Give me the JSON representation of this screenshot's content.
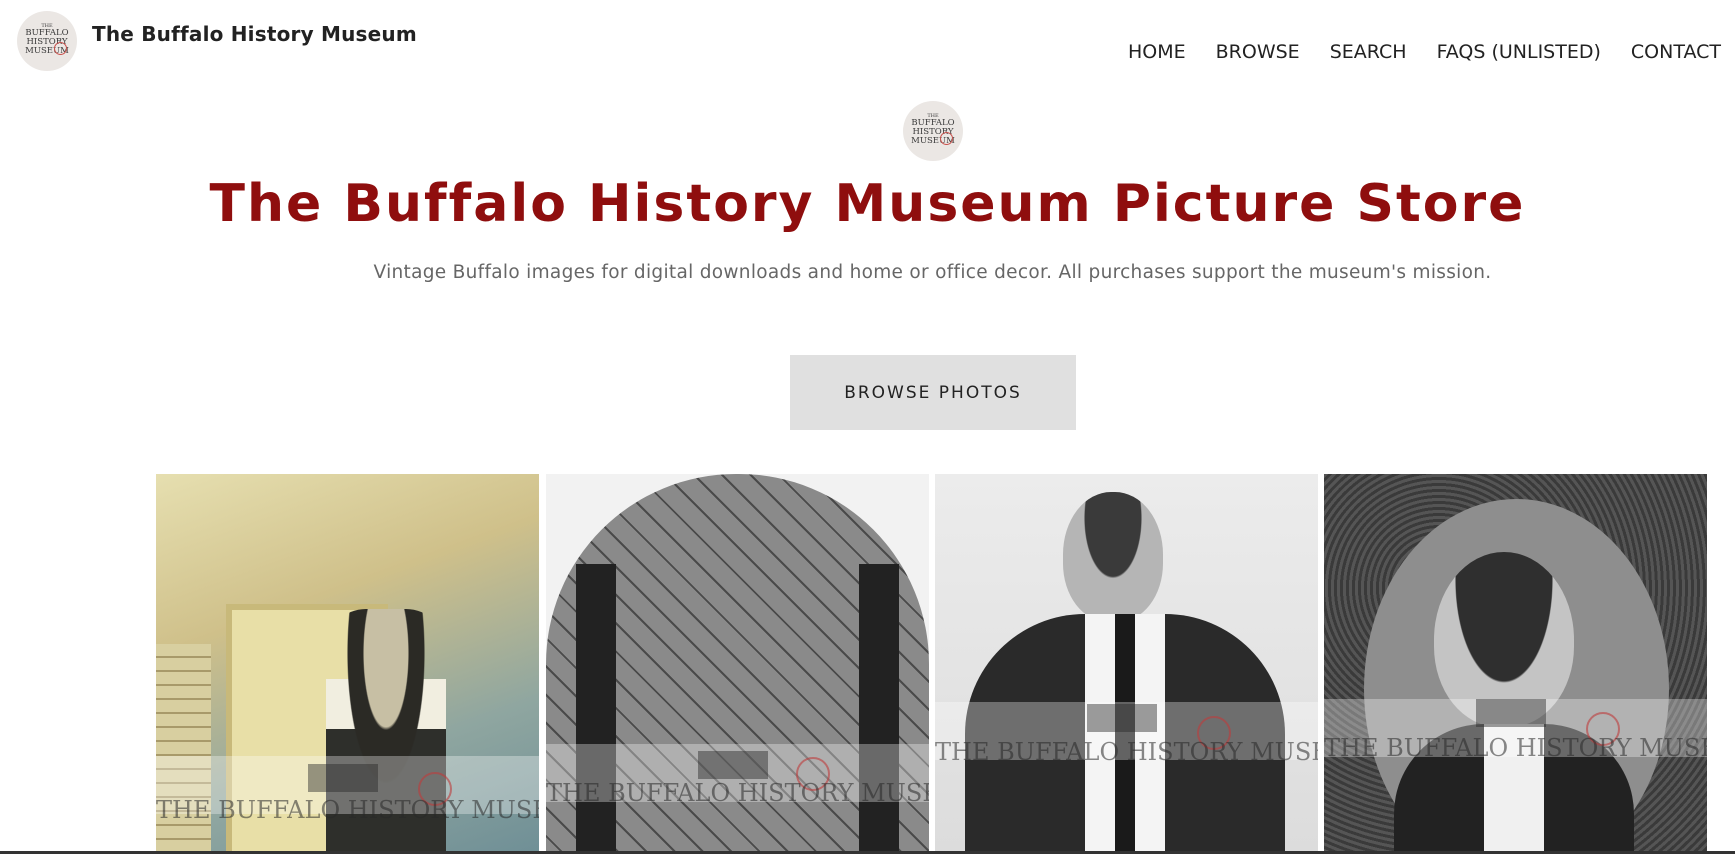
{
  "header": {
    "logo_alt": "The Buffalo History Museum logo",
    "logo_lines": [
      "THE",
      "BUFFALO",
      "HISTORY",
      "MUSEUM"
    ],
    "site_title": "The Buffalo History Museum"
  },
  "nav": {
    "items": [
      {
        "label": "HOME"
      },
      {
        "label": "BROWSE"
      },
      {
        "label": "SEARCH"
      },
      {
        "label": "FAQS (UNLISTED)"
      },
      {
        "label": "CONTACT"
      }
    ]
  },
  "hero": {
    "title": "The Buffalo History Museum Picture Store",
    "subtitle": "Vintage Buffalo images for digital downloads and home or office decor. All purchases support the museum's mission.",
    "button_label": "BROWSE PHOTOS"
  },
  "photos": [
    {
      "alt": "Woman with violin in a parlor",
      "watermark": "THE BUFFALO HISTORY MUSEUM"
    },
    {
      "alt": "Woman in striped dress before stained glass",
      "watermark": "THE BUFFALO HISTORY MUSEUM"
    },
    {
      "alt": "Man in suit and bow tie",
      "watermark": "THE BUFFALO HISTORY MUSEUM"
    },
    {
      "alt": "Oval portrait of a man with wavy hair",
      "watermark": "THE BUFFALO HISTORY MUSEUM"
    }
  ],
  "colors": {
    "title_red": "#8f0e0e",
    "button_bg": "#e0e0e0",
    "logo_bg": "#ebe7e4"
  }
}
